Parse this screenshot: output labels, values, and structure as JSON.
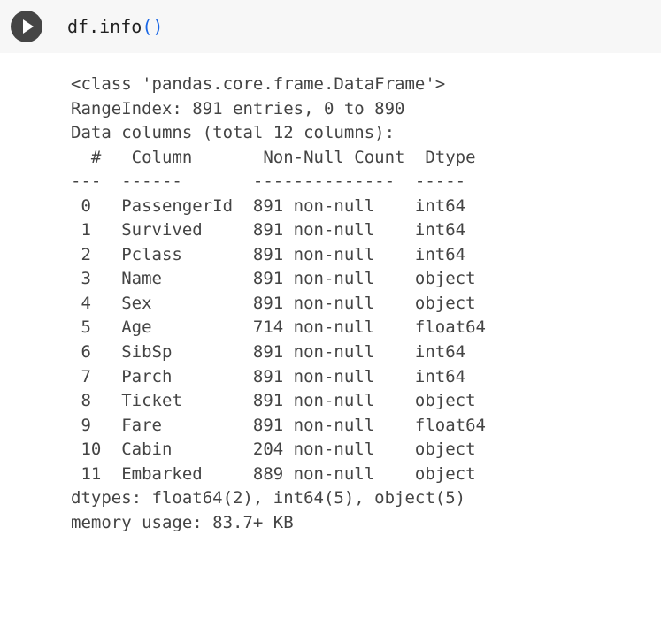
{
  "cell": {
    "code": {
      "obj": "df",
      "dot": ".",
      "method": "info",
      "open": "(",
      "close": ")"
    }
  },
  "output": {
    "class_line": "<class 'pandas.core.frame.DataFrame'>",
    "rangeindex_line": "RangeIndex: 891 entries, 0 to 890",
    "columns_header_line": "Data columns (total 12 columns):",
    "header_idx": " #",
    "header_column": "Column",
    "header_nonnull": "Non-Null Count",
    "header_dtype": "Dtype",
    "sep_idx": "---",
    "sep_column": "------",
    "sep_nonnull": "--------------",
    "sep_dtype": "-----",
    "columns": [
      {
        "idx": " 0 ",
        "name": "PassengerId",
        "nonnull": "891 non-null",
        "dtype": "int64"
      },
      {
        "idx": " 1 ",
        "name": "Survived",
        "nonnull": "891 non-null",
        "dtype": "int64"
      },
      {
        "idx": " 2 ",
        "name": "Pclass",
        "nonnull": "891 non-null",
        "dtype": "int64"
      },
      {
        "idx": " 3 ",
        "name": "Name",
        "nonnull": "891 non-null",
        "dtype": "object"
      },
      {
        "idx": " 4 ",
        "name": "Sex",
        "nonnull": "891 non-null",
        "dtype": "object"
      },
      {
        "idx": " 5 ",
        "name": "Age",
        "nonnull": "714 non-null",
        "dtype": "float64"
      },
      {
        "idx": " 6 ",
        "name": "SibSp",
        "nonnull": "891 non-null",
        "dtype": "int64"
      },
      {
        "idx": " 7 ",
        "name": "Parch",
        "nonnull": "891 non-null",
        "dtype": "int64"
      },
      {
        "idx": " 8 ",
        "name": "Ticket",
        "nonnull": "891 non-null",
        "dtype": "object"
      },
      {
        "idx": " 9 ",
        "name": "Fare",
        "nonnull": "891 non-null",
        "dtype": "float64"
      },
      {
        "idx": " 10",
        "name": "Cabin",
        "nonnull": "204 non-null",
        "dtype": "object"
      },
      {
        "idx": " 11",
        "name": "Embarked",
        "nonnull": "889 non-null",
        "dtype": "object"
      }
    ],
    "dtypes_line": "dtypes: float64(2), int64(5), object(5)",
    "memory_line": "memory usage: 83.7+ KB"
  }
}
